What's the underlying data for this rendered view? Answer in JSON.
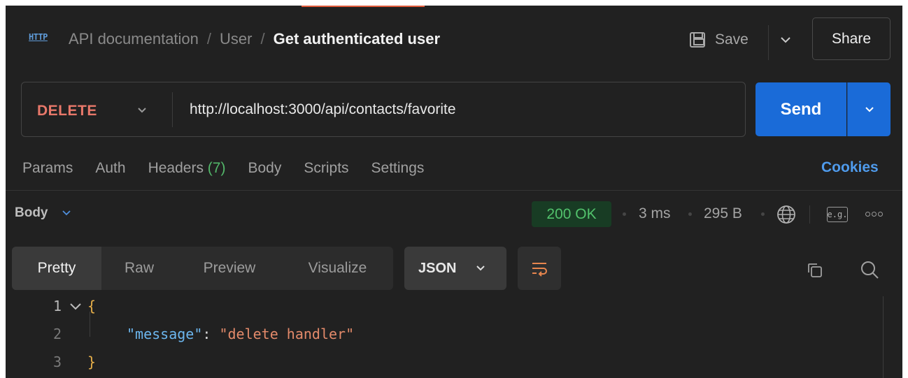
{
  "header": {
    "icon": "http-icon",
    "icon_text": "HTTP",
    "breadcrumb": [
      "API documentation",
      "User"
    ],
    "separator": "/",
    "current": "Get authenticated user",
    "save_label": "Save",
    "share_label": "Share"
  },
  "request": {
    "method": "DELETE",
    "url": "http://localhost:3000/api/contacts/favorite",
    "send_label": "Send",
    "tabs": {
      "params": "Params",
      "auth": "Auth",
      "headers": "Headers",
      "headers_count": "(7)",
      "body": "Body",
      "scripts": "Scripts",
      "settings": "Settings"
    },
    "cookies_label": "Cookies"
  },
  "response": {
    "body_label": "Body",
    "status": "200 OK",
    "time": "3 ms",
    "size": "295 B",
    "eg_label": "e.g.",
    "view_tabs": [
      "Pretty",
      "Raw",
      "Preview",
      "Visualize"
    ],
    "active_view": "Pretty",
    "format": "JSON",
    "code": {
      "line_numbers": [
        "1",
        "2",
        "3"
      ],
      "open_brace": "{",
      "close_brace": "}",
      "key": "\"message\"",
      "colon": ": ",
      "value": "\"delete handler\""
    }
  },
  "colors": {
    "background": "#212121",
    "method": "#e8786a",
    "send": "#1a6bd8",
    "status_ok": "#52c26c",
    "cookies": "#4f9bec",
    "json_key": "#6cb6ee",
    "json_value": "#e38a6a"
  }
}
